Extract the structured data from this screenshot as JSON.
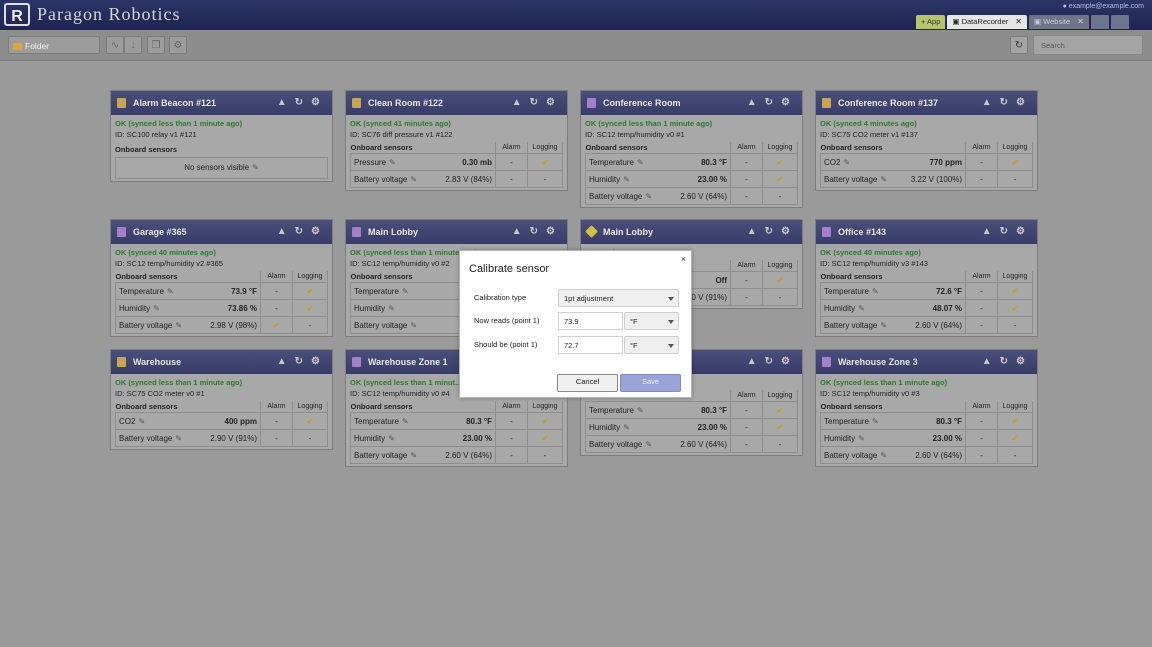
{
  "header": {
    "logo_letter": "R",
    "brand": "Paragon Robotics",
    "user": "example@example.com",
    "tabs": [
      {
        "label": "+ App",
        "kind": "add"
      },
      {
        "label": "DataRecorder",
        "kind": "active",
        "closable": true
      },
      {
        "label": "Website",
        "kind": "dim",
        "closable": true
      }
    ]
  },
  "toolbar": {
    "folder_label": "Folder",
    "search_placeholder": "Search"
  },
  "labels": {
    "onboard_sensors": "Onboard sensors",
    "alarm": "Alarm",
    "logging": "Logging",
    "no_sensors": "No sensors visible",
    "dash": "-"
  },
  "cards": [
    {
      "title": "Alarm Beacon #121",
      "icon": "beacon",
      "status": "OK (synced less than 1 minute ago)",
      "device_id": "ID: SC100 relay v1 #121",
      "sensors": []
    },
    {
      "title": "Clean Room #122",
      "icon": "beacon",
      "status": "OK (synced 41 minutes ago)",
      "device_id": "ID: SC76 diff pressure v1 #122",
      "sensors": [
        {
          "name": "Pressure",
          "value": "0.30 mb",
          "alarm": "-",
          "logging": "check"
        },
        {
          "name": "Battery voltage",
          "value": "2.83 V (84%)",
          "alarm": "-",
          "logging": "-"
        }
      ]
    },
    {
      "title": "Conference Room",
      "icon": "th",
      "status": "OK (synced less than 1 minute ago)",
      "device_id": "ID: SC12 temp/humidity v0 #1",
      "sensors": [
        {
          "name": "Temperature",
          "value": "80.3 °F",
          "alarm": "-",
          "logging": "check"
        },
        {
          "name": "Humidity",
          "value": "23.00 %",
          "alarm": "-",
          "logging": "check"
        },
        {
          "name": "Battery voltage",
          "value": "2.60 V (64%)",
          "alarm": "-",
          "logging": "-"
        }
      ]
    },
    {
      "title": "Conference Room #137",
      "icon": "beacon",
      "status": "OK (synced 4 minutes ago)",
      "device_id": "ID: SC75 CO2 meter v1 #137",
      "sensors": [
        {
          "name": "CO2",
          "value": "770 ppm",
          "alarm": "-",
          "logging": "check"
        },
        {
          "name": "Battery voltage",
          "value": "3.22 V (100%)",
          "alarm": "-",
          "logging": "-"
        }
      ]
    },
    {
      "title": "Garage #365",
      "icon": "th",
      "status": "OK (synced 40 minutes ago)",
      "device_id": "ID: SC12 temp/humidity v2 #365",
      "sensors": [
        {
          "name": "Temperature",
          "value": "73.9 °F",
          "alarm": "-",
          "logging": "check"
        },
        {
          "name": "Humidity",
          "value": "73.86 %",
          "alarm": "-",
          "logging": "check"
        },
        {
          "name": "Battery voltage",
          "value": "2.98 V (98%)",
          "alarm": "check",
          "logging": "-"
        }
      ]
    },
    {
      "title": "Main Lobby",
      "icon": "th",
      "status": "OK (synced less than 1 minute ago)",
      "device_id": "ID: SC12 temp/humidity v0 #2",
      "sensors": [
        {
          "name": "Temperature",
          "value": "",
          "alarm": "",
          "logging": ""
        },
        {
          "name": "Humidity",
          "value": "",
          "alarm": "",
          "logging": ""
        },
        {
          "name": "Battery voltage",
          "value": "2.6",
          "alarm": "",
          "logging": ""
        }
      ]
    },
    {
      "title": "Main Lobby",
      "icon": "warn",
      "status": "...te ago)",
      "device_id": "",
      "sensors": [
        {
          "name": "",
          "value": "Off",
          "alarm": "-",
          "logging": "check"
        },
        {
          "name": "",
          "value": "...0 V (91%)",
          "alarm": "-",
          "logging": "-"
        }
      ]
    },
    {
      "title": "Office #143",
      "icon": "th",
      "status": "OK (synced 40 minutes ago)",
      "device_id": "ID: SC12 temp/humidity v3 #143",
      "sensors": [
        {
          "name": "Temperature",
          "value": "72.6 °F",
          "alarm": "-",
          "logging": "check"
        },
        {
          "name": "Humidity",
          "value": "48.07 %",
          "alarm": "-",
          "logging": "check"
        },
        {
          "name": "Battery voltage",
          "value": "2.60 V (64%)",
          "alarm": "-",
          "logging": "-"
        }
      ]
    },
    {
      "title": "Warehouse",
      "icon": "beacon",
      "status": "OK (synced less than 1 minute ago)",
      "device_id": "ID: SC75 CO2 meter v0 #1",
      "sensors": [
        {
          "name": "CO2",
          "value": "400 ppm",
          "alarm": "-",
          "logging": "check"
        },
        {
          "name": "Battery voltage",
          "value": "2.90 V (91%)",
          "alarm": "-",
          "logging": "-"
        }
      ]
    },
    {
      "title": "Warehouse Zone 1",
      "icon": "th",
      "status": "OK (synced less than 1 minut...",
      "device_id": "ID: SC12 temp/humidity v0 #4",
      "sensors": [
        {
          "name": "Temperature",
          "value": "80.3 °F",
          "alarm": "-",
          "logging": "check"
        },
        {
          "name": "Humidity",
          "value": "23.00 %",
          "alarm": "-",
          "logging": "check"
        },
        {
          "name": "Battery voltage",
          "value": "2.60 V (64%)",
          "alarm": "-",
          "logging": "-"
        }
      ]
    },
    {
      "title": "",
      "icon": "th",
      "status": "...ute ago)",
      "device_id": "",
      "sensors": [
        {
          "name": "Temperature",
          "value": "80.3 °F",
          "alarm": "-",
          "logging": "check"
        },
        {
          "name": "Humidity",
          "value": "23.00 %",
          "alarm": "-",
          "logging": "check"
        },
        {
          "name": "Battery voltage",
          "value": "2.60 V (64%)",
          "alarm": "-",
          "logging": "-"
        }
      ]
    },
    {
      "title": "Warehouse Zone 3",
      "icon": "th",
      "status": "OK (synced less than 1 minute ago)",
      "device_id": "ID: SC12 temp/humidity v0 #3",
      "sensors": [
        {
          "name": "Temperature",
          "value": "80.3 °F",
          "alarm": "-",
          "logging": "check"
        },
        {
          "name": "Humidity",
          "value": "23.00 %",
          "alarm": "-",
          "logging": "check"
        },
        {
          "name": "Battery voltage",
          "value": "2.60 V (64%)",
          "alarm": "-",
          "logging": "-"
        }
      ]
    }
  ],
  "modal": {
    "title": "Calibrate sensor",
    "close": "×",
    "calibration_type_label": "Calibration type",
    "calibration_type_value": "1pt adjustment",
    "now_reads_label": "Now reads (point 1)",
    "now_reads_value": "73.9",
    "now_reads_unit": "°F",
    "should_be_label": "Should be (point 1)",
    "should_be_value": "72.7",
    "should_be_unit": "°F",
    "cancel_label": "Cancel",
    "save_label": "Save"
  }
}
